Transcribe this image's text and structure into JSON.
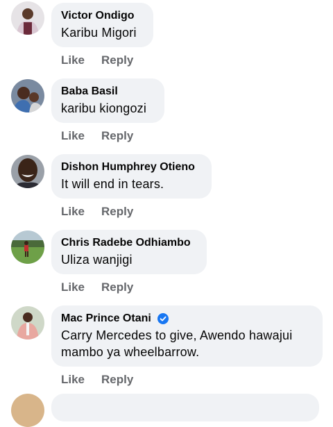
{
  "comments": [
    {
      "author": "Victor Ondigo",
      "text": "Karibu Migori"
    },
    {
      "author": "Baba Basil",
      "text": "karibu kiongozi"
    },
    {
      "author": "Dishon Humphrey Otieno",
      "text": "It will end in tears."
    },
    {
      "author": "Chris Radebe Odhiambo",
      "text": "Uliza wanjigi"
    },
    {
      "author": "Mac Prince Otani",
      "text": "Carry Mercedes to give, Awendo hawajui mambo ya wheelbarrow.",
      "verified": true
    }
  ],
  "actions": {
    "like": "Like",
    "reply": "Reply"
  },
  "colors": {
    "bubble": "#f0f2f5",
    "action_text": "#65676b",
    "verified_badge": "#1877f2"
  }
}
